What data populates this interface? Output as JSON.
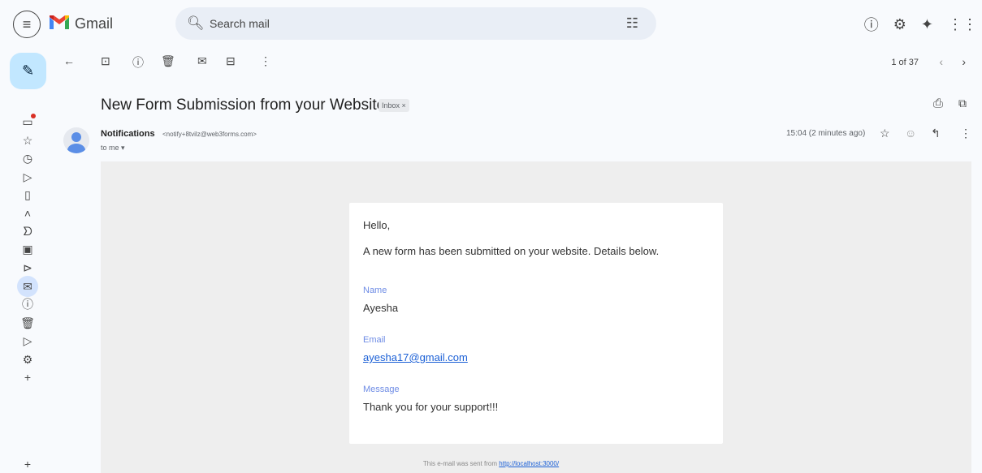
{
  "header": {
    "brand": "Gmail",
    "search_placeholder": "Search mail"
  },
  "toolbar": {
    "pager": "1 of 37"
  },
  "message": {
    "subject": "New Form Submission from your Website",
    "label": "Inbox ×",
    "sender_name": "Notifications",
    "sender_email": "<notify+8tvilz@web3forms.com>",
    "to": "to me ▾",
    "time": "15:04 (2 minutes ago)"
  },
  "body": {
    "greeting": "Hello,",
    "intro": "A new form has been submitted on your website. Details below.",
    "fields": [
      {
        "label": "Name",
        "value": "Ayesha"
      },
      {
        "label": "Email",
        "value": "ayesha17@gmail.com"
      },
      {
        "label": "Message",
        "value": "Thank you for your support!!!"
      }
    ],
    "footer_text": "This e-mail was sent from",
    "footer_link": "http://localhost:3000/"
  },
  "colors": {
    "compose_bg": "#c2e7ff",
    "search_bg": "#e9eef6",
    "field_label": "#6e8ce5",
    "link": "#1a5fd6"
  }
}
